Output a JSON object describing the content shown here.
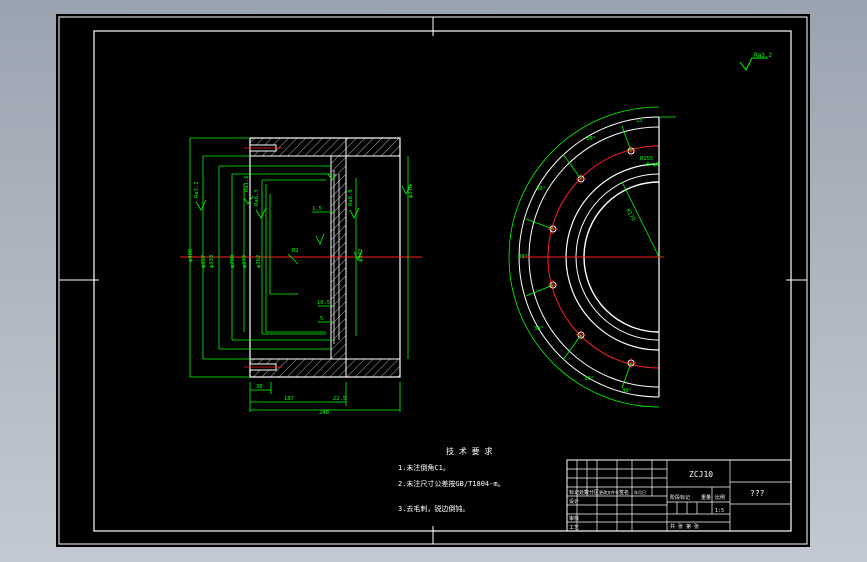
{
  "drawing": {
    "title_block": {
      "part_code": "ZCJ10",
      "part_name": "???",
      "scale": "1:5",
      "row_labels": [
        "标记",
        "设计",
        "审核",
        "工艺"
      ],
      "columns": [
        "处数",
        "分区",
        "更改文件号",
        "签名",
        "年月日"
      ],
      "stage_label": "阶段标记",
      "weight_label": "重量",
      "ratio_label": "比例",
      "sheet_label": "共 张 第 张"
    },
    "technical_requirements": {
      "heading": "技 术 要 求",
      "lines": [
        "1.未注倒角C1。",
        "2.未注尺寸公差按GB/T1804-m。",
        "3.去毛刺，锐边倒钝。"
      ]
    },
    "roughness_note": "Ra3.2",
    "left_view": {
      "dims": [
        "φ380",
        "φ357",
        "φ338",
        "φ280",
        "φ272",
        "φ262",
        "φ318",
        "φ342",
        "1.5",
        "16.5",
        "5",
        "30",
        "187",
        "22.5",
        "240",
        "R2",
        "Ra3.2",
        "Ra1.6",
        "Ra6.3",
        "Ra0.8"
      ]
    },
    "right_view": {
      "dims": [
        "15",
        "30°",
        "30°",
        "30°",
        "30°",
        "30°",
        "30°",
        "R170",
        "R155",
        "8×φ9"
      ]
    }
  }
}
